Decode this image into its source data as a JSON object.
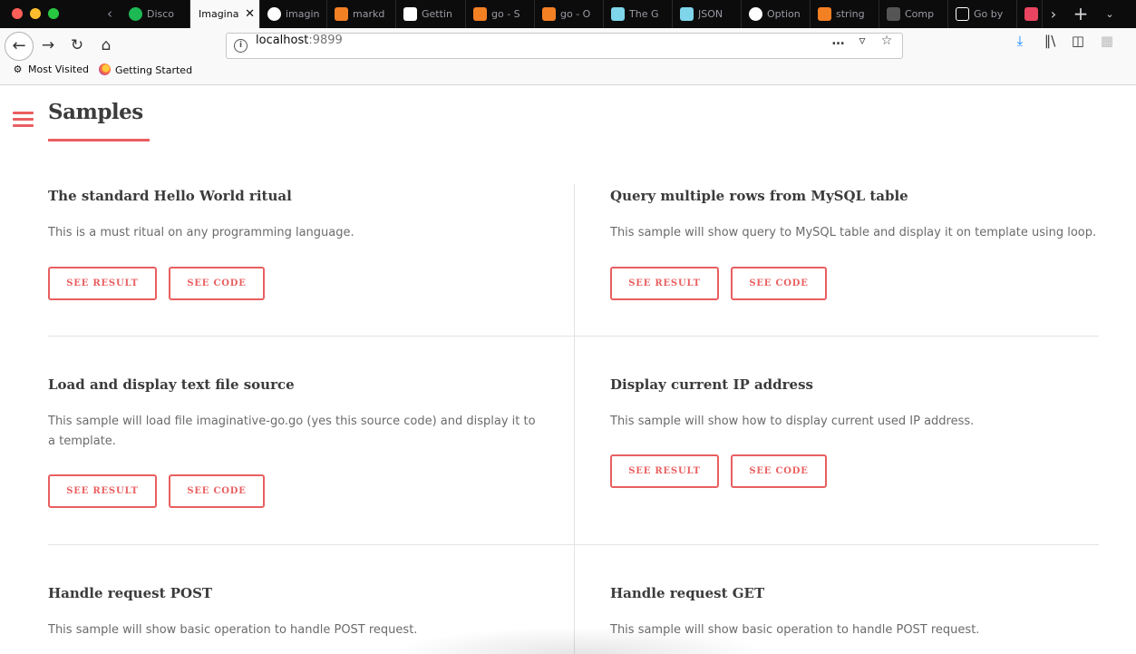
{
  "browser": {
    "tabs": [
      {
        "title": "Disco",
        "icon": "spotify-icon",
        "color": "#1db954"
      },
      {
        "title": "Imaginative",
        "icon": "none",
        "color": "#ffffff",
        "active": true
      },
      {
        "title": "imagin",
        "icon": "github-icon",
        "color": "#ffffff"
      },
      {
        "title": "markd",
        "icon": "stackoverflow-icon",
        "color": "#f48024"
      },
      {
        "title": "Gettin",
        "icon": "medium-icon",
        "color": "#ffffff"
      },
      {
        "title": "go - S",
        "icon": "stackoverflow-icon",
        "color": "#f48024"
      },
      {
        "title": "go - O",
        "icon": "stackoverflow-icon",
        "color": "#f48024"
      },
      {
        "title": "The G",
        "icon": "gopher-icon",
        "color": "#7fd5ea"
      },
      {
        "title": "JSON",
        "icon": "gopher-icon",
        "color": "#7fd5ea"
      },
      {
        "title": "Option",
        "icon": "github-icon",
        "color": "#ffffff"
      },
      {
        "title": "string",
        "icon": "stackoverflow-icon",
        "color": "#f48024"
      },
      {
        "title": "Comp",
        "icon": "page-icon",
        "color": "#555555"
      },
      {
        "title": "Go by",
        "icon": "braces-icon",
        "color": "#ffffff"
      },
      {
        "title": "",
        "icon": "app-icon",
        "color": "#e94560"
      }
    ],
    "url_host": "localhost",
    "url_port": ":9899",
    "bookmarks": [
      "Most Visited",
      "Getting Started"
    ]
  },
  "page": {
    "title": "Samples",
    "accent_color": "#e95f60",
    "samples": [
      {
        "title": "The standard Hello World ritual",
        "description": "This is a must ritual on any programming language.",
        "result_label": "SEE RESULT",
        "code_label": "SEE CODE"
      },
      {
        "title": "Query multiple rows from MySQL table",
        "description": "This sample will show query to MySQL table and display it on template using loop.",
        "result_label": "SEE RESULT",
        "code_label": "SEE CODE"
      },
      {
        "title": "Load and display text file source",
        "description": "This sample will load file imaginative-go.go (yes this source code) and display it to a template.",
        "result_label": "SEE RESULT",
        "code_label": "SEE CODE"
      },
      {
        "title": "Display current IP address",
        "description": "This sample will show how to display current used IP address.",
        "result_label": "SEE RESULT",
        "code_label": "SEE CODE"
      },
      {
        "title": "Handle request POST",
        "description": "This sample will show basic operation to handle POST request."
      },
      {
        "title": "Handle request GET",
        "description": "This sample will show basic operation to handle POST request."
      }
    ]
  }
}
